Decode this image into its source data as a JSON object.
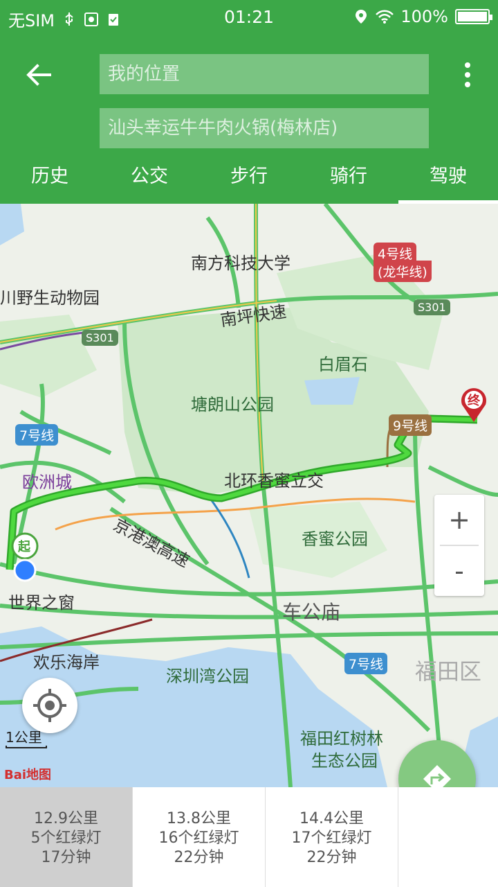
{
  "status_bar": {
    "carrier": "无SIM",
    "time": "01:21",
    "battery": "100%"
  },
  "header": {
    "start_placeholder": "我的位置",
    "end_value": "汕头幸运牛牛肉火锅(梅林店)",
    "tabs": [
      {
        "label": "历史"
      },
      {
        "label": "公交"
      },
      {
        "label": "步行"
      },
      {
        "label": "骑行"
      },
      {
        "label": "驾驶",
        "active": true
      }
    ]
  },
  "map": {
    "labels": {
      "sustech": "南方科技大学",
      "zoo": "川野生动物园",
      "nanping": "南坪快速",
      "baimeishi": "白眉石",
      "tanglang": "塘朗山公园",
      "ouzhou": "欧洲城",
      "beihuan": "北环香蜜立交",
      "jinggang": "京港澳高速",
      "xiangmi": "香蜜公园",
      "window": "世界之窗",
      "chegongmiao": "车公庙",
      "happy_coast": "欢乐海岸",
      "sz_bay": "深圳湾公园",
      "futian_district": "福田区",
      "mangrove_1": "福田红树林",
      "mangrove_2": "生态公园",
      "start_marker": "起",
      "end_marker": "终"
    },
    "badges": {
      "line4_1": "4号线",
      "line4_2": "(龙华线)",
      "s301_a": "S301",
      "s301_b": "S301",
      "line7_a": "7号线",
      "line7_b": "7号线",
      "line9": "9号线"
    },
    "scale": "1公里",
    "logo": "Bai地图",
    "zoom_in": "+",
    "zoom_out": "-"
  },
  "route_options": [
    {
      "distance": "12.9公里",
      "lights": "5个红绿灯",
      "time": "17分钟",
      "selected": true
    },
    {
      "distance": "13.8公里",
      "lights": "16个红绿灯",
      "time": "22分钟",
      "selected": false
    },
    {
      "distance": "14.4公里",
      "lights": "17个红绿灯",
      "time": "22分钟",
      "selected": false
    }
  ],
  "colors": {
    "primary": "#3ca848",
    "route": "#36c02e",
    "road": "#5cc46a",
    "water": "#b8d8f2",
    "end_marker": "#c8262e"
  }
}
